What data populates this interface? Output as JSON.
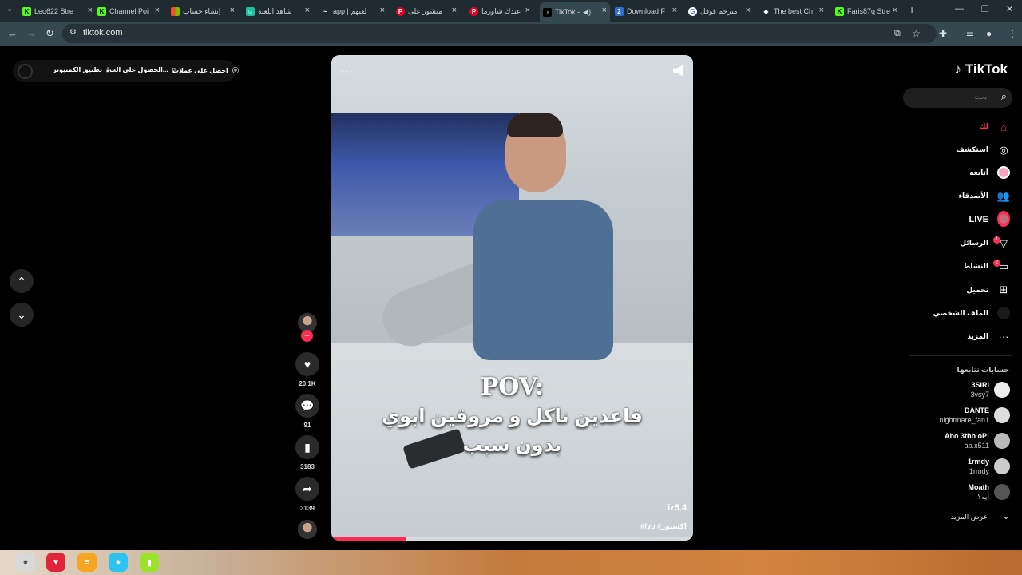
{
  "browser": {
    "tabs": [
      {
        "label": "Leo622 Stre",
        "fav": "K",
        "fav_color": "#53fc18"
      },
      {
        "label": "Channel Poi",
        "fav": "K",
        "fav_color": "#53fc18"
      },
      {
        "label": "إنشاء حساب",
        "fav": "■",
        "fav_color": "#f25022"
      },
      {
        "label": "شاهد اللعبة",
        "fav": "☺",
        "fav_color": "#1cc29f"
      },
      {
        "label": "app | لعيهم",
        "fav": "~",
        "fav_color": "#1f2b30"
      },
      {
        "label": "منشور على",
        "fav": "P",
        "fav_color": "#e60023"
      },
      {
        "label": "عندك شاورما",
        "fav": "P",
        "fav_color": "#e60023"
      },
      {
        "label": "TikTok -",
        "fav": "♪",
        "fav_color": "#000000"
      },
      {
        "label": "Download F",
        "fav": "2",
        "fav_color": "#2f6fd1"
      },
      {
        "label": "مترجم قوقل",
        "fav": "G",
        "fav_color": "#ffffff"
      },
      {
        "label": "The best Ch",
        "fav": "◆",
        "fav_color": "#1f2b30"
      },
      {
        "label": "Faris87q Stre",
        "fav": "K",
        "fav_color": "#53fc18"
      }
    ],
    "new_tab": "+",
    "url": "tiktok.com"
  },
  "topbar": {
    "get_coins": "احصل على عملات",
    "get_app": "الحصول على الت...",
    "desktop_app": "تطبيق الكمبيوتر"
  },
  "video": {
    "pov": "POV:",
    "caption_line1": "قاعدين ناكل و مروقين ابوي",
    "caption_line2": "بدون سبب",
    "watermark": "iz5.4",
    "hashtags": "#fyp #اكسبور",
    "progress": 0.205
  },
  "actions": {
    "likes": "20.1K",
    "comments": "91",
    "saves": "3183",
    "shares": "3139"
  },
  "sidebar": {
    "logo": "TikTok",
    "search_placeholder": "بحث",
    "nav": [
      {
        "label": "لك",
        "icon": "home-icon"
      },
      {
        "label": "استكشف",
        "icon": "compass-icon"
      },
      {
        "label": "أتابعه",
        "icon": "following-icon"
      },
      {
        "label": "الأصدقاء",
        "icon": "friends-icon"
      },
      {
        "label": "LIVE",
        "icon": "live-icon"
      },
      {
        "label": "الرسائل",
        "icon": "messages-icon"
      },
      {
        "label": "النشاط",
        "icon": "activity-icon"
      },
      {
        "label": "تحميل",
        "icon": "upload-icon"
      },
      {
        "label": "الملف الشخصي",
        "icon": "profile-icon"
      },
      {
        "label": "المزيد",
        "icon": "more-icon"
      }
    ],
    "messages_badge": "1",
    "activity_badge": "2",
    "following_heading": "حسابات تتابعها",
    "accounts": [
      {
        "name": "3SIRI",
        "user": "3vsy7"
      },
      {
        "name": "DANTE",
        "user": "nightmare_fan1"
      },
      {
        "name": "Abo 3tbb oP!",
        "user": "ab.x511"
      },
      {
        "name": "1rmdy",
        "user": "1rmdy"
      },
      {
        "name": "Moath",
        "user": "أيه؟"
      }
    ],
    "see_more": "عرض المزيد"
  }
}
